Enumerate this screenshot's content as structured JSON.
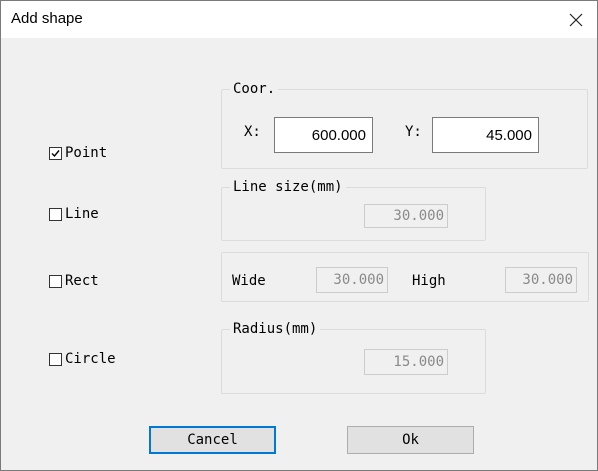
{
  "window": {
    "title": "Add shape"
  },
  "shapes": {
    "point": {
      "label": "Point",
      "checked": true
    },
    "line": {
      "label": "Line",
      "checked": false
    },
    "rect": {
      "label": "Rect",
      "checked": false
    },
    "circle": {
      "label": "Circle",
      "checked": false
    }
  },
  "coor": {
    "legend": "Coor.",
    "x_label": "X:",
    "x_value": "600.000",
    "y_label": "Y:",
    "y_value": "45.000"
  },
  "line_size": {
    "legend": "Line size(mm)",
    "value": "30.000"
  },
  "rect_size": {
    "wide_label": "Wide",
    "wide_value": "30.000",
    "high_label": "High",
    "high_value": "30.000"
  },
  "radius": {
    "legend": "Radius(mm)",
    "value": "15.000"
  },
  "buttons": {
    "cancel": "Cancel",
    "ok": "Ok"
  },
  "colors": {
    "default_button_border": "#0078d7",
    "window_bg": "#f0f0f0"
  }
}
